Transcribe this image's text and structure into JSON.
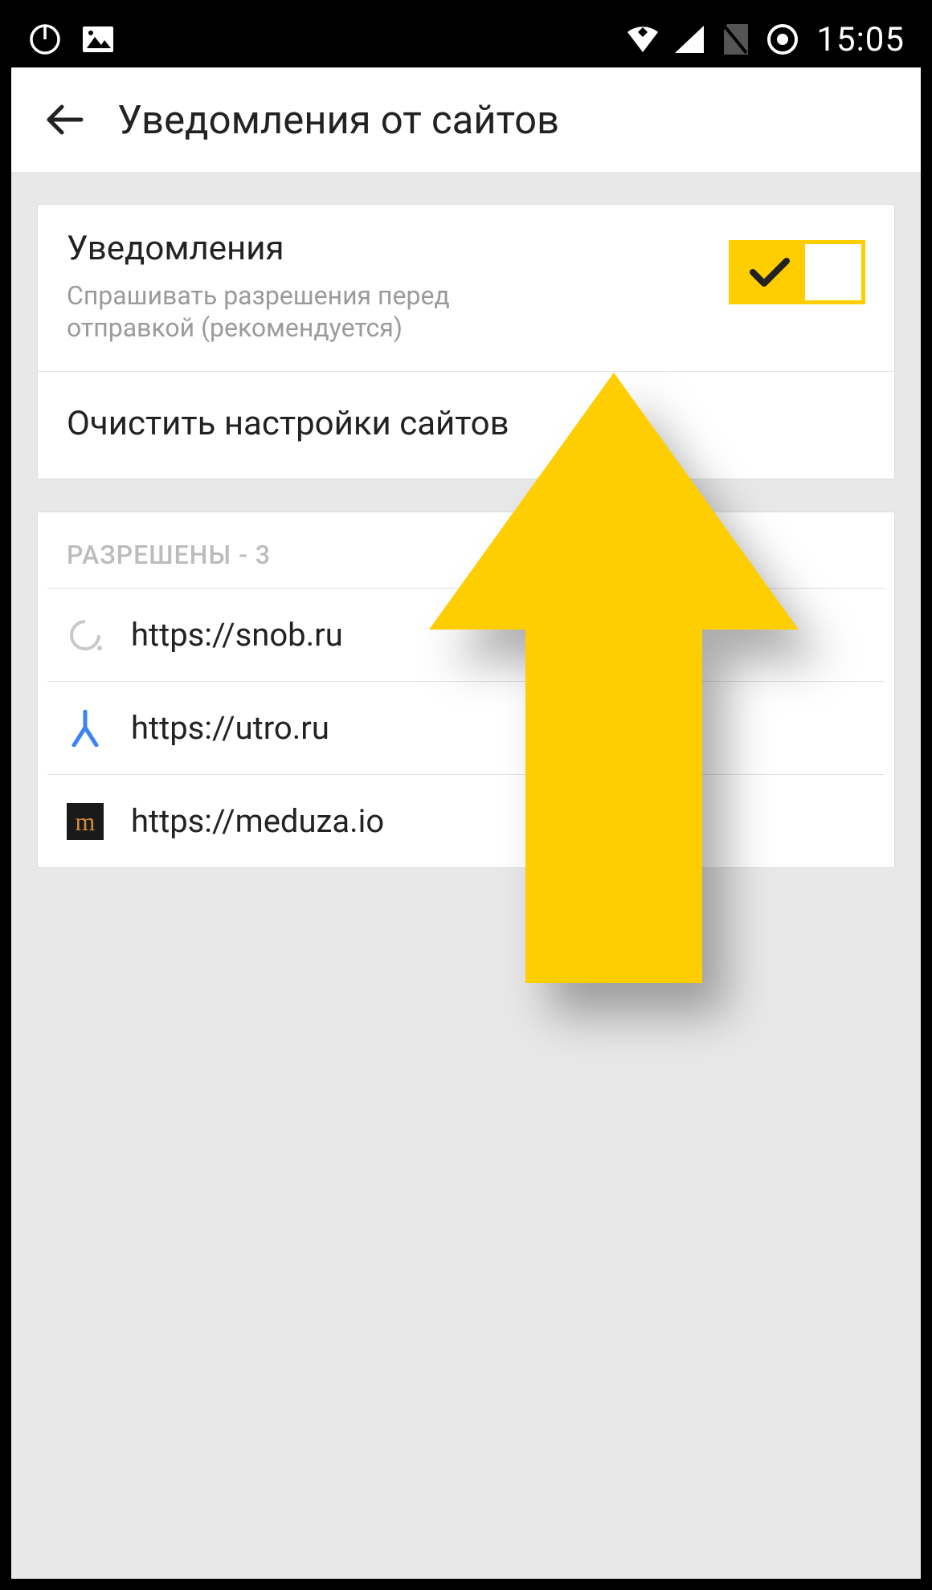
{
  "statusbar": {
    "time": "15:05"
  },
  "appbar": {
    "title": "Уведомления от сайтов"
  },
  "notif": {
    "title": "Уведомления",
    "subtitle": "Спрашивать разрешения перед отправкой (рекомендуется)",
    "clear": "Очистить настройки сайтов"
  },
  "allowed": {
    "header": "РАЗРЕШЕНЫ - 3",
    "sites": [
      {
        "url": "https://snob.ru"
      },
      {
        "url": "https://utro.ru"
      },
      {
        "url": "https://meduza.io"
      }
    ]
  },
  "meduza_glyph": "m"
}
